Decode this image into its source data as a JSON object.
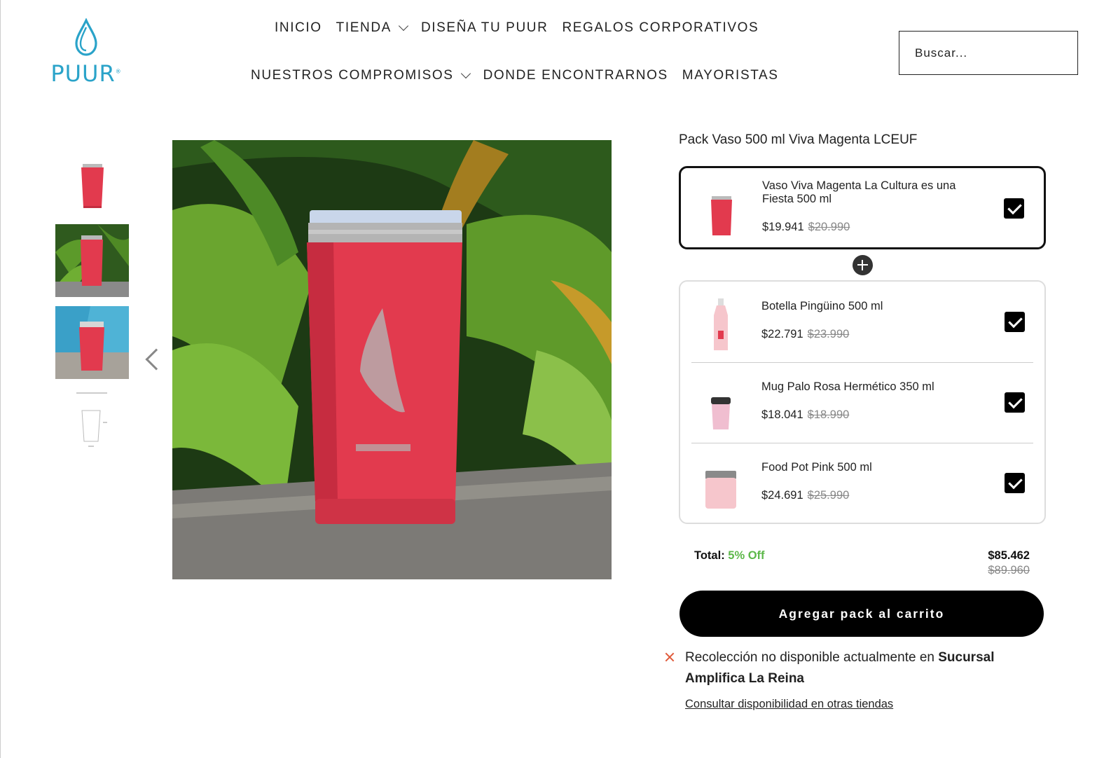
{
  "brand": {
    "name": "PUUR",
    "logo_color": "#2aa3c9"
  },
  "nav": {
    "row1": [
      {
        "label": "INICIO",
        "dropdown": false
      },
      {
        "label": "TIENDA",
        "dropdown": true
      },
      {
        "label": "DISEÑA TU PUUR",
        "dropdown": false
      },
      {
        "label": "REGALOS CORPORATIVOS",
        "dropdown": false
      }
    ],
    "row2": [
      {
        "label": "NUESTROS COMPROMISOS",
        "dropdown": true
      },
      {
        "label": "DONDE ENCONTRARNOS",
        "dropdown": false
      },
      {
        "label": "MAYORISTAS",
        "dropdown": false
      }
    ]
  },
  "search": {
    "placeholder": "Buscar...",
    "icon": "search-icon"
  },
  "gallery": {
    "thumbnails": [
      {
        "name": "thumb-tumbler-white"
      },
      {
        "name": "thumb-tumbler-plants"
      },
      {
        "name": "thumb-tumbler-pool"
      },
      {
        "name": "thumb-tumbler-dimensions"
      }
    ],
    "prev_icon": "chevron-left-icon"
  },
  "pack": {
    "title": "Pack Vaso 500 ml Viva Magenta LCEUF",
    "main_item": {
      "name": "Vaso Viva Magenta La Cultura es una Fiesta 500 ml",
      "price": "$19.941",
      "old_price": "$20.990",
      "checked": true
    },
    "items": [
      {
        "name": "Botella Pingüino 500 ml",
        "price": "$22.791",
        "old_price": "$23.990",
        "checked": true
      },
      {
        "name": "Mug Palo Rosa Hermético 350 ml",
        "price": "$18.041",
        "old_price": "$18.990",
        "checked": true
      },
      {
        "name": "Food Pot Pink 500 ml",
        "price": "$24.691",
        "old_price": "$25.990",
        "checked": true
      }
    ],
    "total_label": "Total:",
    "discount": "5% Off",
    "total_price": "$85.462",
    "total_old_price": "$89.960",
    "add_button": "Agregar pack al carrito"
  },
  "pickup": {
    "text": "Recolección no disponible actualmente en ",
    "store": "Sucursal Amplifica La Reina",
    "link": "Consultar disponibilidad en otras tiendas"
  },
  "colors": {
    "accent_green": "#5db84a",
    "error_red": "#e05a3a",
    "product_red": "#e23a4e"
  }
}
